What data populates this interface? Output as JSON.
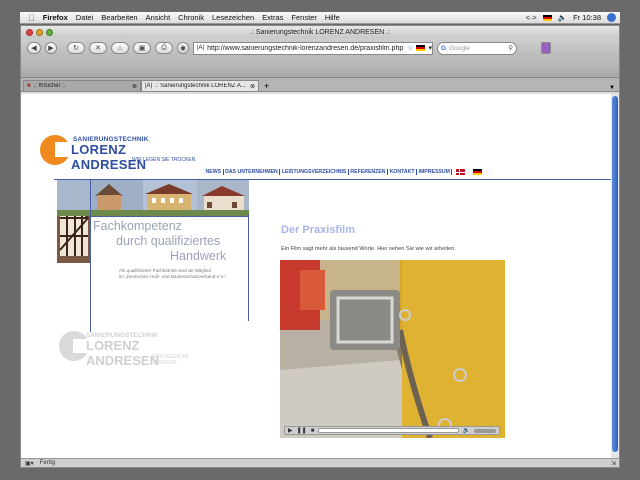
{
  "menubar": {
    "app": "Firefox",
    "items": [
      "Datei",
      "Bearbeiten",
      "Ansicht",
      "Chronik",
      "Lesezeichen",
      "Extras",
      "Fenster",
      "Hilfe"
    ],
    "clock": "Fr 10:38",
    "extra": "<·>"
  },
  "window": {
    "title": ".: Sanierungstechnik LORENZ ANDRESEN .:"
  },
  "toolbar": {
    "url": "http://www.sanierungstechnik-lorenzandresen.de/praxisfilm.php",
    "search_placeholder": "Google"
  },
  "tabs": [
    {
      "label": ".: fhSicher :."
    },
    {
      "label": ".: Sanierungstechnik LORENZ A..."
    }
  ],
  "status": "Fertig",
  "site": {
    "logo": {
      "line1": "SANIERUNGSTECHNIK",
      "line2": "LORENZ ANDRESEN",
      "line3": "WIR LEGEN SIE TROCKEN"
    },
    "nav": [
      "NEWS",
      "DAS UNTERNEHMEN",
      "LEISTUNGSVERZEICHNIS",
      "REFERENZEN",
      "KONTAKT",
      "IMPRESSUM"
    ],
    "slogan": {
      "line1": "Fachkompetenz",
      "line2": "durch qualifiziertes",
      "line3": "Handwerk"
    },
    "member": {
      "line1": "Als qualifizierter Fachbetrieb sind wir Mitglied",
      "line2": "im „Deutschen Holz- und Bautenschutzverband e.V.“."
    },
    "heading": "Der Praxisfilm",
    "intro": "Ein Film sagt mehr als tausend Worte. Hier sehen Sie wie wir arbeiten."
  }
}
